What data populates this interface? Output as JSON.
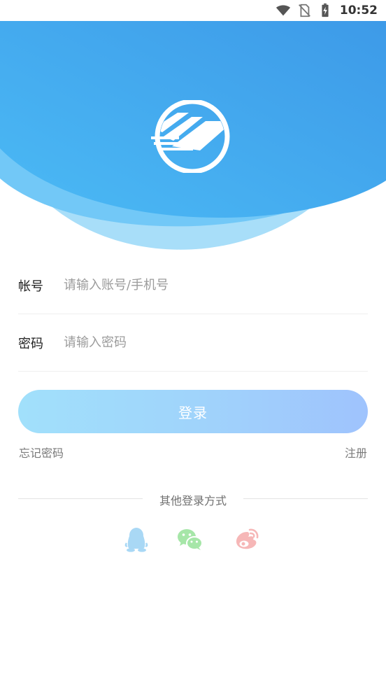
{
  "status_bar": {
    "time": "10:52",
    "icons": [
      "wifi-icon",
      "no-sim-icon",
      "battery-charging-icon"
    ]
  },
  "brand": {
    "logo_icon": "app-logo-icon",
    "colors": {
      "hero_top": "#3d9ae8",
      "hero_bottom": "#4bbaf5",
      "button_start": "#a1e0fb",
      "button_end": "#9fc3fd"
    }
  },
  "form": {
    "account": {
      "label": "帐号",
      "placeholder": "请输入账号/手机号",
      "value": ""
    },
    "password": {
      "label": "密码",
      "placeholder": "请输入密码",
      "value": ""
    },
    "login_label": "登录",
    "forgot_label": "忘记密码",
    "register_label": "注册"
  },
  "other_login": {
    "title": "其他登录方式",
    "providers": [
      {
        "icon": "qq-icon",
        "color": "#a9d8f5"
      },
      {
        "icon": "wechat-icon",
        "color": "#a6e6a8"
      },
      {
        "icon": "weibo-icon",
        "color": "#f6b7b7"
      }
    ]
  }
}
